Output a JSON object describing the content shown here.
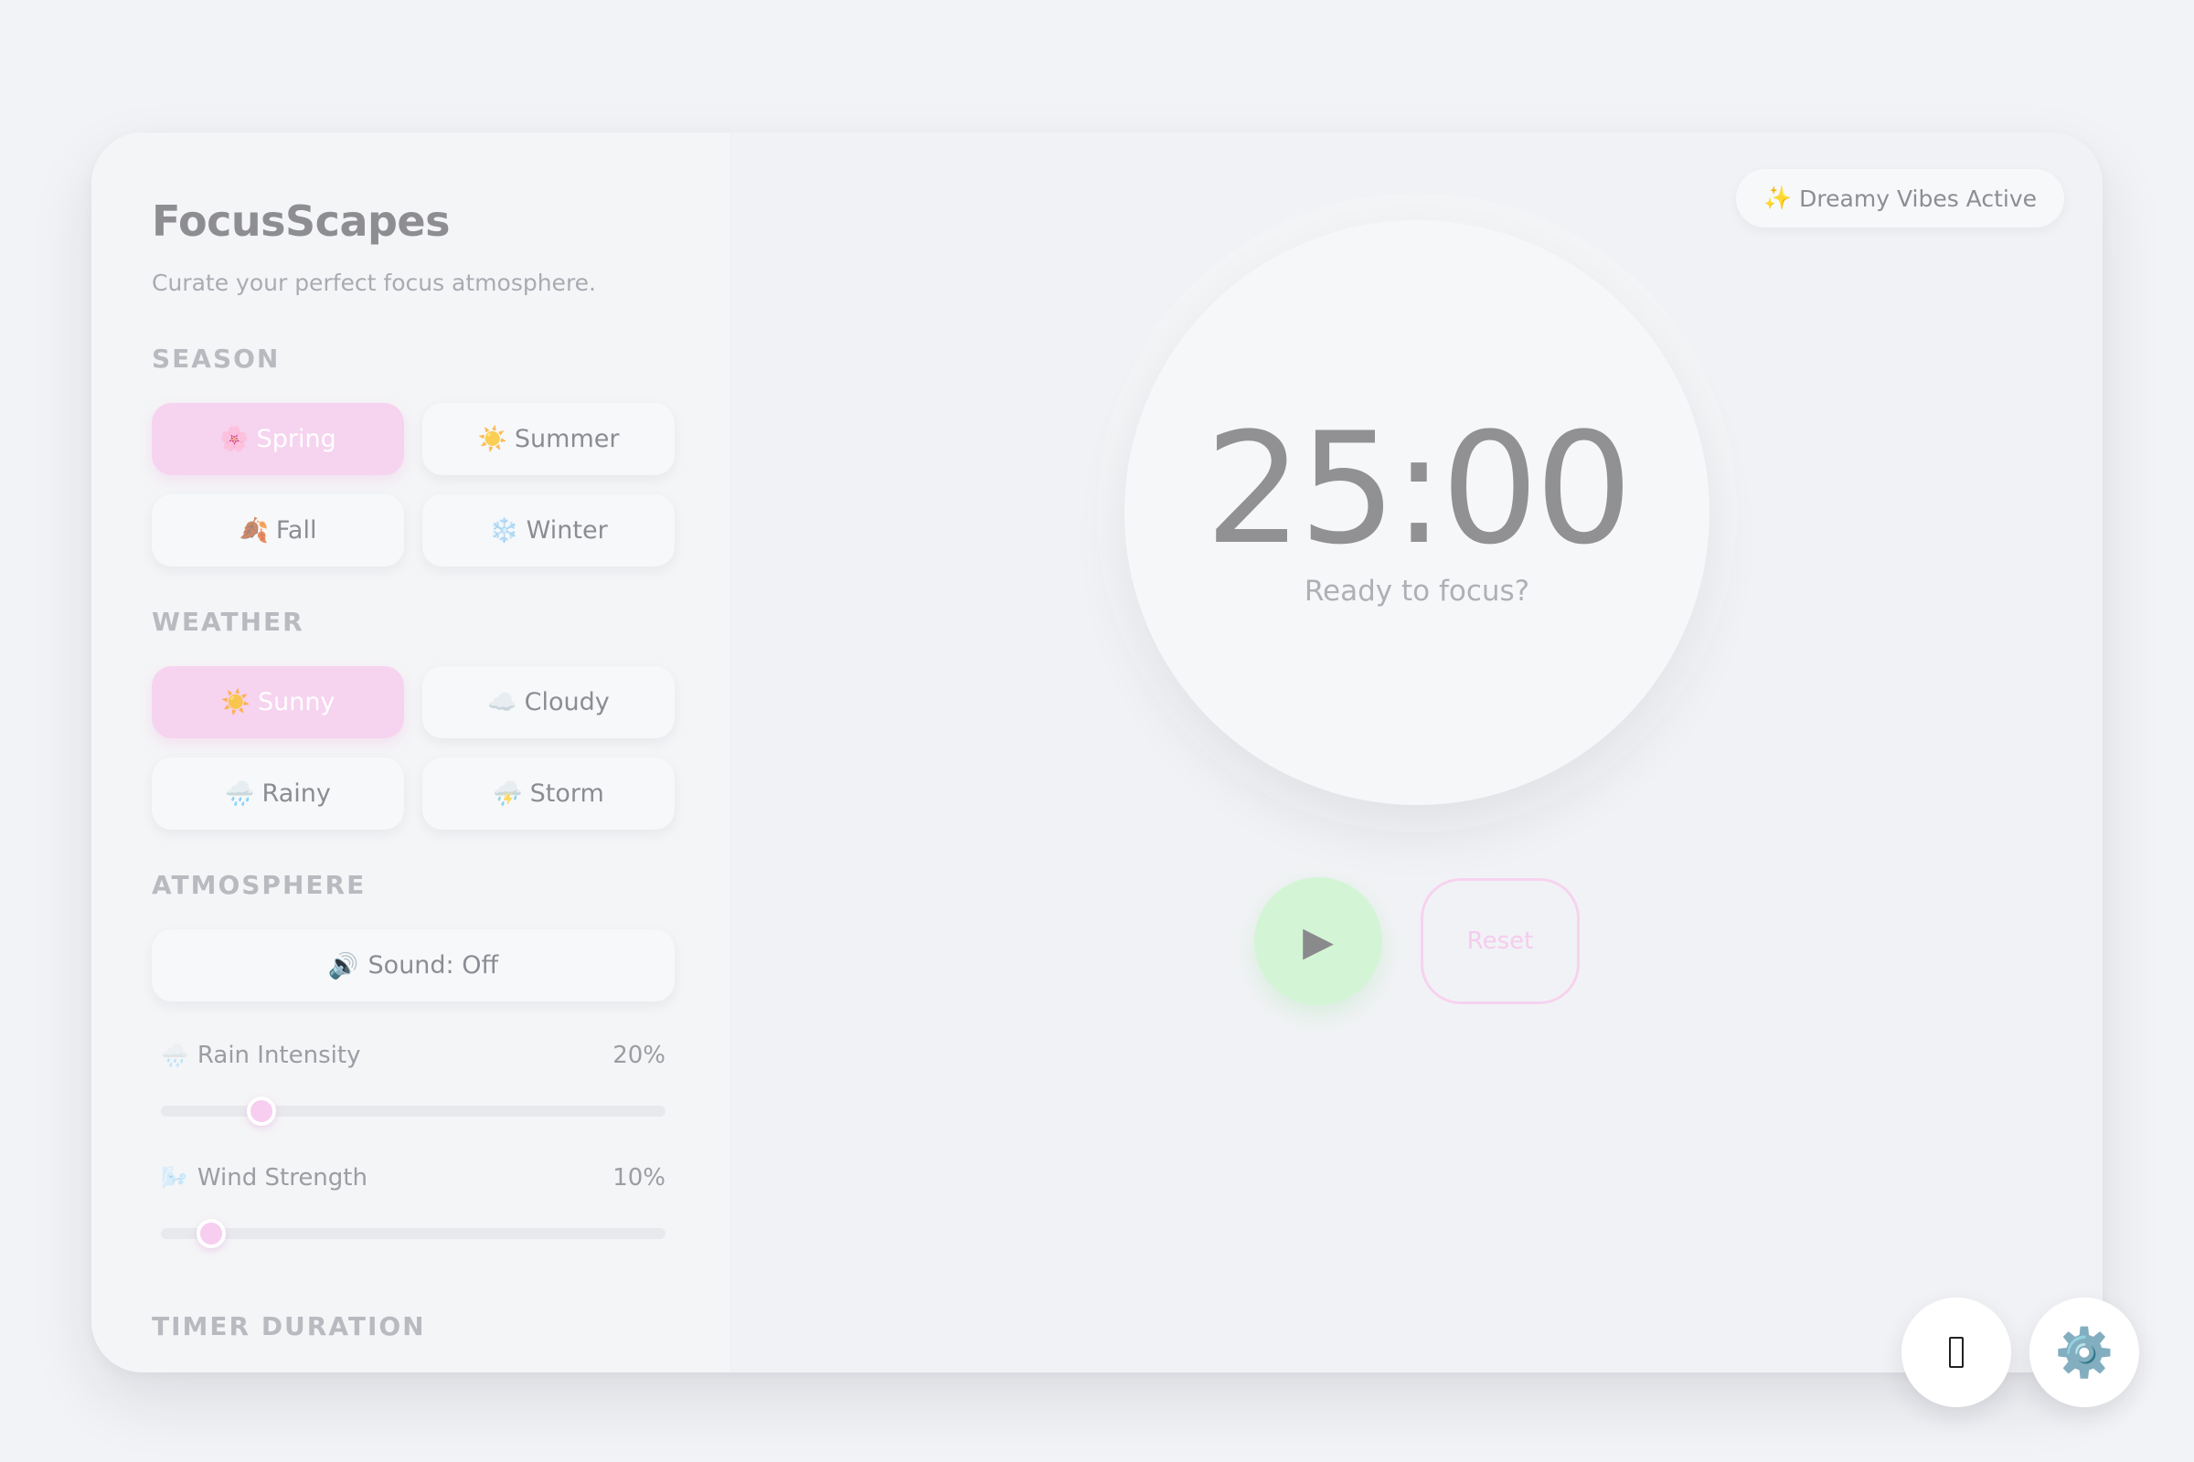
{
  "sidebar": {
    "title": "FocusScapes",
    "subtitle": "Curate your perfect focus atmosphere.",
    "season": {
      "label": "SEASON",
      "options": [
        {
          "icon": "🌸",
          "label": "Spring",
          "active": true
        },
        {
          "icon": "☀️",
          "label": "Summer",
          "active": false
        },
        {
          "icon": "🍂",
          "label": "Fall",
          "active": false
        },
        {
          "icon": "❄️",
          "label": "Winter",
          "active": false
        }
      ]
    },
    "weather": {
      "label": "WEATHER",
      "options": [
        {
          "icon": "☀️",
          "label": "Sunny",
          "active": true
        },
        {
          "icon": "☁️",
          "label": "Cloudy",
          "active": false
        },
        {
          "icon": "🌧️",
          "label": "Rainy",
          "active": false
        },
        {
          "icon": "⛈️",
          "label": "Storm",
          "active": false
        }
      ]
    },
    "atmosphere": {
      "label": "ATMOSPHERE",
      "sound_icon": "🔊",
      "sound_label": "Sound: Off",
      "rain": {
        "icon": "🌧️",
        "label": "Rain Intensity",
        "value_text": "20%",
        "value": 20
      },
      "wind": {
        "icon": "🌬️",
        "label": "Wind Strength",
        "value_text": "10%",
        "value": 10
      }
    },
    "timer_duration_label": "TIMER DURATION"
  },
  "main": {
    "badge_icon": "✨",
    "badge_label": "Dreamy Vibes Active",
    "timer": {
      "time": "25:00",
      "status": "Ready to focus?"
    },
    "controls": {
      "play_icon": "▶",
      "reset_label": "Reset"
    }
  },
  "fabs": {
    "settings_icon": "⚙️"
  },
  "colors": {
    "accent_pink": "#f6d3ef",
    "play_green": "#d3f5d6",
    "settings_blue": "#5d8db2"
  }
}
